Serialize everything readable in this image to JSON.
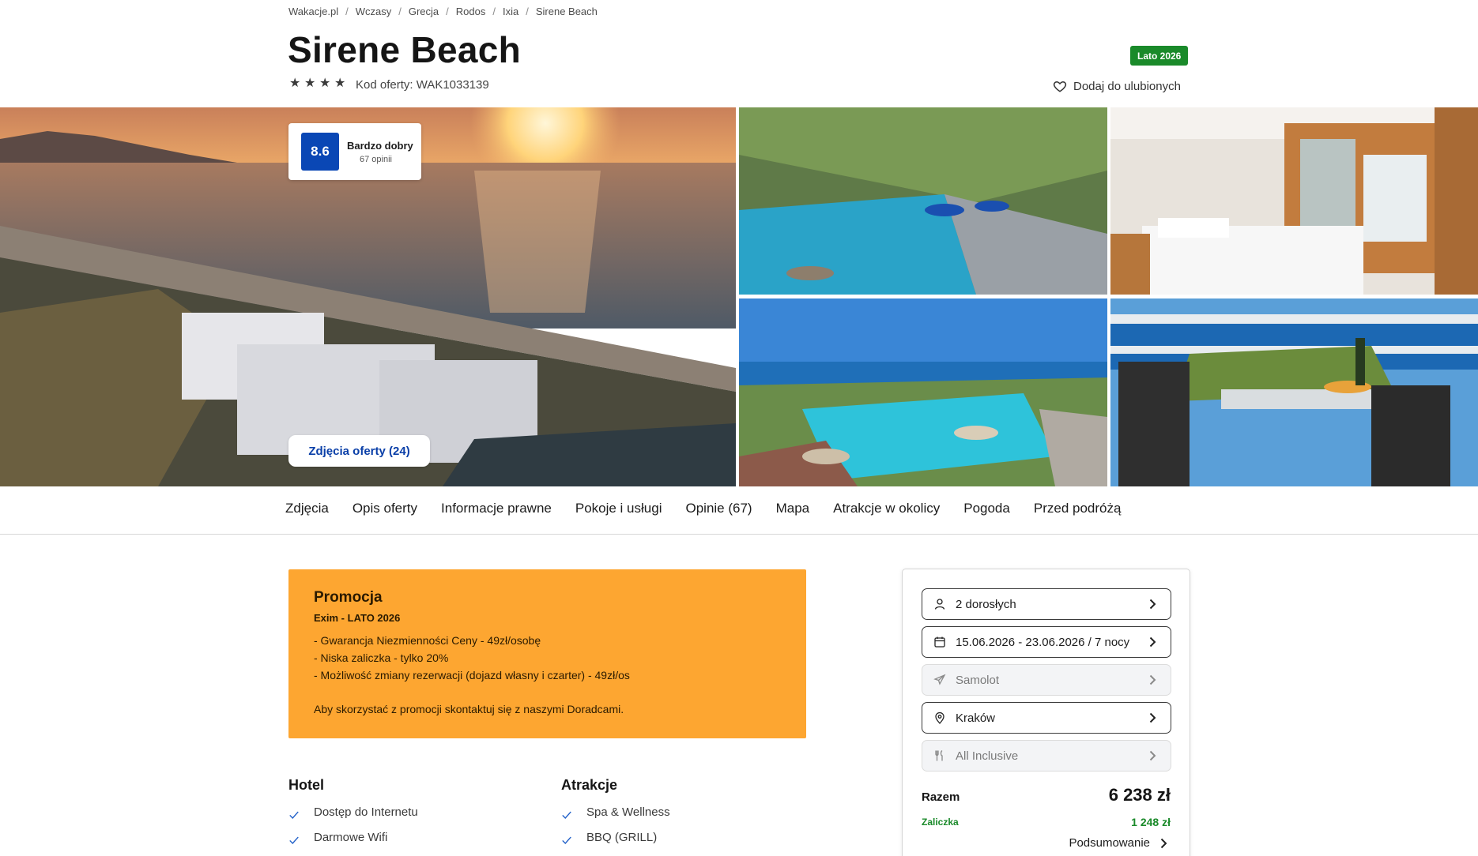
{
  "breadcrumb": [
    "Wakacje.pl",
    "Wczasy",
    "Grecja",
    "Rodos",
    "Ixia",
    "Sirene Beach"
  ],
  "hotel": {
    "name": "Sirene Beach",
    "stars": 4,
    "offer_code": "Kod oferty: WAK1033139",
    "season_badge": "Lato 2026",
    "favorite_label": "Dodaj do ulubionych"
  },
  "rating": {
    "score": "8.6",
    "label": "Bardzo dobry",
    "count": "67 opinii"
  },
  "gallery": {
    "photos_button": "Zdjęcia oferty (24)"
  },
  "tabs": [
    "Zdjęcia",
    "Opis oferty",
    "Informacje prawne",
    "Pokoje i usługi",
    "Opinie (67)",
    "Mapa",
    "Atrakcje w okolicy",
    "Pogoda",
    "Przed podróżą"
  ],
  "promo": {
    "title": "Promocja",
    "subtitle": "Exim - LATO 2026",
    "lines": [
      "- Gwarancja Niezmienności Ceny - 49zł/osobę",
      "- Niska zaliczka - tylko 20%",
      "- Możliwość zmiany rezerwacji (dojazd własny i czarter) - 49zł/os"
    ],
    "note": "Aby skorzystać z promocji skontaktuj się z naszymi Doradcami."
  },
  "features": {
    "hotel": {
      "title": "Hotel",
      "items": [
        "Dostęp do Internetu",
        "Darmowe Wifi"
      ]
    },
    "attractions": {
      "title": "Atrakcje",
      "items": [
        "Spa & Wellness",
        "BBQ (GRILL)"
      ]
    }
  },
  "booking": {
    "guests": "2 dorosłych",
    "dates": "15.06.2026 - 23.06.2026 / 7 nocy",
    "transport": "Samolot",
    "departure": "Kraków",
    "board": "All Inclusive",
    "total_label": "Razem",
    "total_value": "6 238 zł",
    "deposit_label": "Zaliczka",
    "deposit_value": "1 248 zł",
    "summary_label": "Podsumowanie"
  },
  "colors": {
    "accent_blue": "#0a47b5",
    "promo_orange": "#fda631",
    "green": "#1a8a2a"
  }
}
